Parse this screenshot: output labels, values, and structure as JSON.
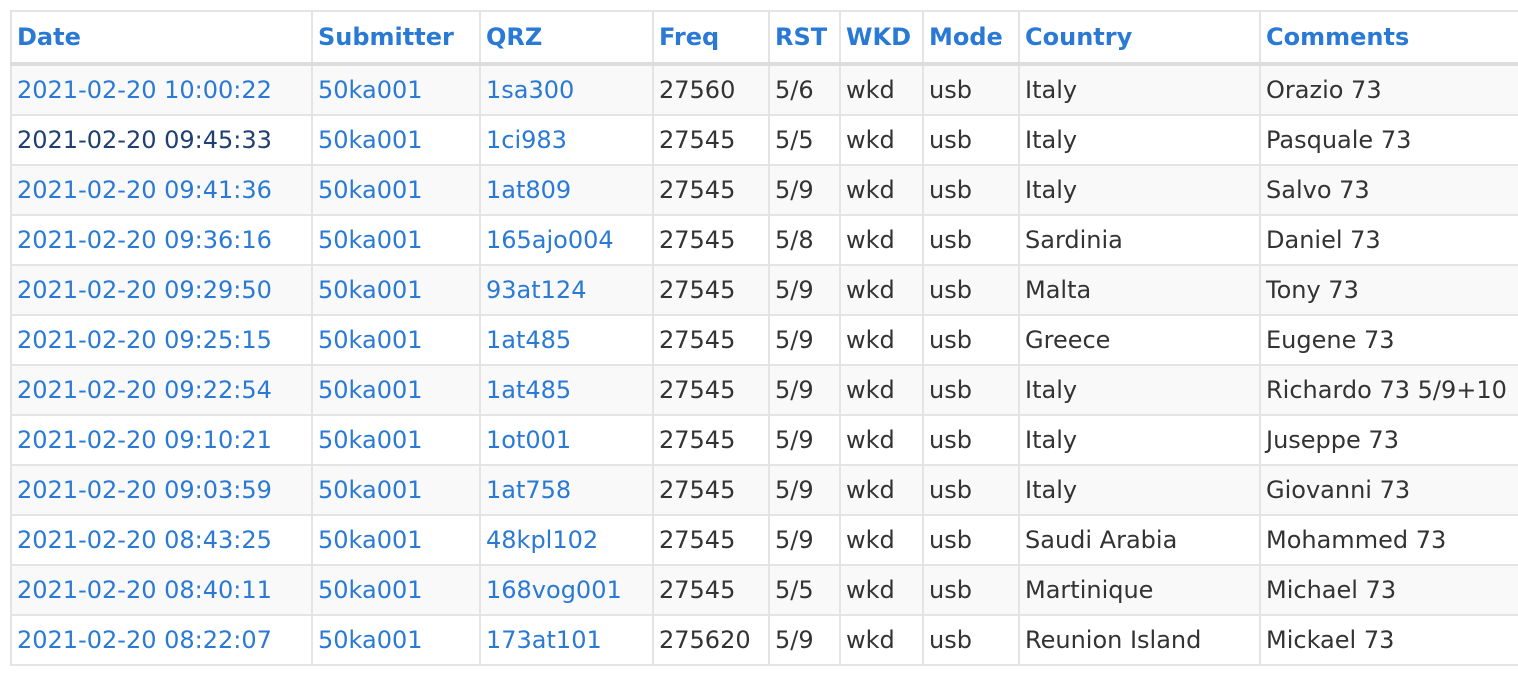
{
  "headers": [
    "Date",
    "Submitter",
    "QRZ",
    "Freq",
    "RST",
    "WKD",
    "Mode",
    "Country",
    "Comments"
  ],
  "rows": [
    {
      "date": "2021-02-20 10:00:22",
      "submitter": "50ka001",
      "qrz": "1sa300",
      "freq": "27560",
      "rst": "5/6",
      "wkd": "wkd",
      "mode": "usb",
      "country": "Italy",
      "comments": "Orazio 73"
    },
    {
      "date": "2021-02-20 09:45:33",
      "submitter": "50ka001",
      "qrz": "1ci983",
      "freq": "27545",
      "rst": "5/5",
      "wkd": "wkd",
      "mode": "usb",
      "country": "Italy",
      "comments": "Pasquale 73"
    },
    {
      "date": "2021-02-20 09:41:36",
      "submitter": "50ka001",
      "qrz": "1at809",
      "freq": "27545",
      "rst": "5/9",
      "wkd": "wkd",
      "mode": "usb",
      "country": "Italy",
      "comments": "Salvo 73"
    },
    {
      "date": "2021-02-20 09:36:16",
      "submitter": "50ka001",
      "qrz": "165ajo004",
      "freq": "27545",
      "rst": "5/8",
      "wkd": "wkd",
      "mode": "usb",
      "country": "Sardinia",
      "comments": "Daniel 73"
    },
    {
      "date": "2021-02-20 09:29:50",
      "submitter": "50ka001",
      "qrz": "93at124",
      "freq": "27545",
      "rst": "5/9",
      "wkd": "wkd",
      "mode": "usb",
      "country": "Malta",
      "comments": "Tony 73"
    },
    {
      "date": "2021-02-20 09:25:15",
      "submitter": "50ka001",
      "qrz": "1at485",
      "freq": "27545",
      "rst": "5/9",
      "wkd": "wkd",
      "mode": "usb",
      "country": "Greece",
      "comments": "Eugene 73"
    },
    {
      "date": "2021-02-20 09:22:54",
      "submitter": "50ka001",
      "qrz": "1at485",
      "freq": "27545",
      "rst": "5/9",
      "wkd": "wkd",
      "mode": "usb",
      "country": "Italy",
      "comments": "Richardo 73 5/9+10"
    },
    {
      "date": "2021-02-20 09:10:21",
      "submitter": "50ka001",
      "qrz": "1ot001",
      "freq": "27545",
      "rst": "5/9",
      "wkd": "wkd",
      "mode": "usb",
      "country": "Italy",
      "comments": "Juseppe 73"
    },
    {
      "date": "2021-02-20 09:03:59",
      "submitter": "50ka001",
      "qrz": "1at758",
      "freq": "27545",
      "rst": "5/9",
      "wkd": "wkd",
      "mode": "usb",
      "country": "Italy",
      "comments": "Giovanni 73"
    },
    {
      "date": "2021-02-20 08:43:25",
      "submitter": "50ka001",
      "qrz": "48kpl102",
      "freq": "27545",
      "rst": "5/9",
      "wkd": "wkd",
      "mode": "usb",
      "country": "Saudi Arabia",
      "comments": "Mohammed 73"
    },
    {
      "date": "2021-02-20 08:40:11",
      "submitter": "50ka001",
      "qrz": "168vog001",
      "freq": "27545",
      "rst": "5/5",
      "wkd": "wkd",
      "mode": "usb",
      "country": "Martinique",
      "comments": "Michael 73"
    },
    {
      "date": "2021-02-20 08:22:07",
      "submitter": "50ka001",
      "qrz": "173at101",
      "freq": "275620",
      "rst": "5/9",
      "wkd": "wkd",
      "mode": "usb",
      "country": "Reunion Island",
      "comments": "Mickael 73"
    }
  ],
  "colors": {
    "link": "#2a7ad5",
    "visited_link": "#1f3f73",
    "text": "#333333",
    "border": "#e4e4e4",
    "stripe": "#f9f9f9"
  }
}
